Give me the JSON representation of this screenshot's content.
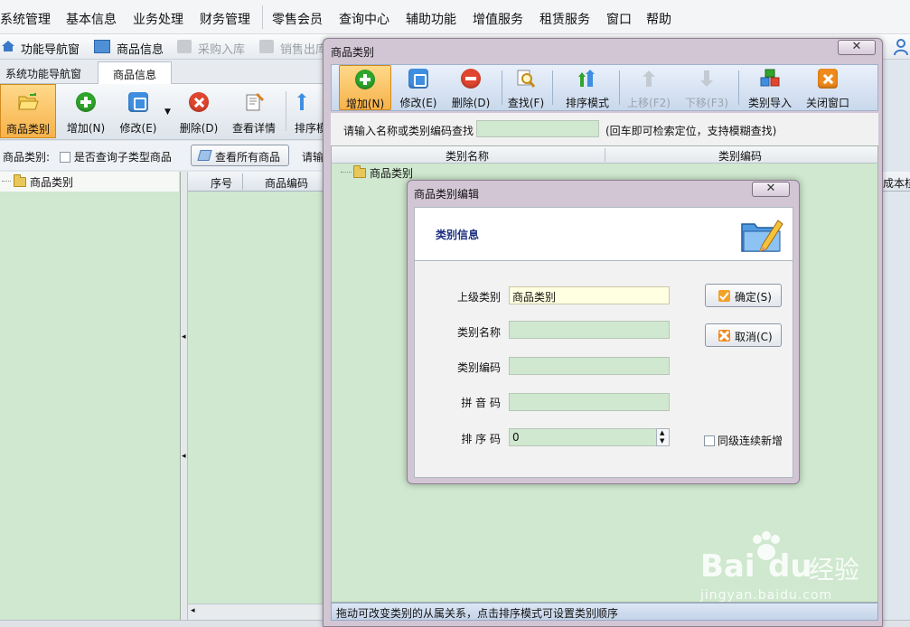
{
  "menubar": {
    "items": [
      "系统管理",
      "基本信息",
      "业务处理",
      "财务管理",
      "零售会员",
      "查询中心",
      "辅助功能",
      "增值服务",
      "租赁服务",
      "窗口",
      "帮助"
    ]
  },
  "quickbar": {
    "items": [
      {
        "label": "功能导航窗",
        "disabled": false
      },
      {
        "label": "商品信息",
        "disabled": false
      },
      {
        "label": "采购入库",
        "disabled": true
      },
      {
        "label": "销售出库",
        "disabled": true
      }
    ]
  },
  "tabs": [
    "系统功能导航窗",
    "商品信息"
  ],
  "main_toolbar": {
    "buttons": [
      "商品类别",
      "增加(N)",
      "修改(E)",
      "删除(D)",
      "查看详情",
      "排序模式"
    ]
  },
  "filter": {
    "category_label": "商品类别:",
    "subtype_checkbox": "是否查询子类型商品",
    "view_all_button": "查看所有商品",
    "search_hint_partial": "请输"
  },
  "left_tree": {
    "root": "商品类别"
  },
  "grid": {
    "columns": [
      "序号",
      "商品编码"
    ],
    "partial_right_col": "成本核"
  },
  "category_dialog": {
    "title": "商品类别",
    "close": "✕",
    "toolbar": [
      {
        "label": "增加(N)",
        "icon": "add-icon",
        "disabled": false
      },
      {
        "label": "修改(E)",
        "icon": "edit-icon",
        "disabled": false
      },
      {
        "label": "删除(D)",
        "icon": "delete-icon",
        "disabled": false
      },
      {
        "label": "查找(F)",
        "icon": "search-icon",
        "disabled": false
      },
      {
        "label": "排序模式",
        "icon": "sort-icon",
        "disabled": false
      },
      {
        "label": "上移(F2)",
        "icon": "move-up-icon",
        "disabled": true
      },
      {
        "label": "下移(F3)",
        "icon": "move-down-icon",
        "disabled": true
      },
      {
        "label": "类别导入",
        "icon": "import-icon",
        "disabled": false
      },
      {
        "label": "关闭窗口",
        "icon": "close-window-icon",
        "disabled": false
      }
    ],
    "search_label": "请输入名称或类别编码查找",
    "search_value": "",
    "search_hint": "(回车即可检索定位，支持模糊查找)",
    "tree_columns": [
      "类别名称",
      "类别编码"
    ],
    "tree_root": "商品类别",
    "status": "拖动可改变类别的从属关系，点击排序模式可设置类别顺序"
  },
  "edit_dialog": {
    "title": "商品类别编辑",
    "close": "✕",
    "header": "类别信息",
    "fields": [
      {
        "label": "上级类别",
        "value": "商品类别"
      },
      {
        "label": "类别名称",
        "value": ""
      },
      {
        "label": "类别编码",
        "value": ""
      },
      {
        "label": "拼 音 码",
        "value": ""
      },
      {
        "label": "排 序 码",
        "value": "0"
      }
    ],
    "ok_button": "确定(S)",
    "cancel_button": "取消(C)",
    "continue_checkbox": "同级连续新增"
  },
  "watermark": {
    "brand": "Bai",
    "brand2": "du",
    "cn": "经验",
    "url": "jingyan.baidu.com"
  },
  "colors": {
    "accent_orange": "#f6b24a",
    "green_bg": "#cfe8cf",
    "add_green": "#2fa52b",
    "delete_red": "#e0452f",
    "edit_blue": "#3f8ee0"
  }
}
